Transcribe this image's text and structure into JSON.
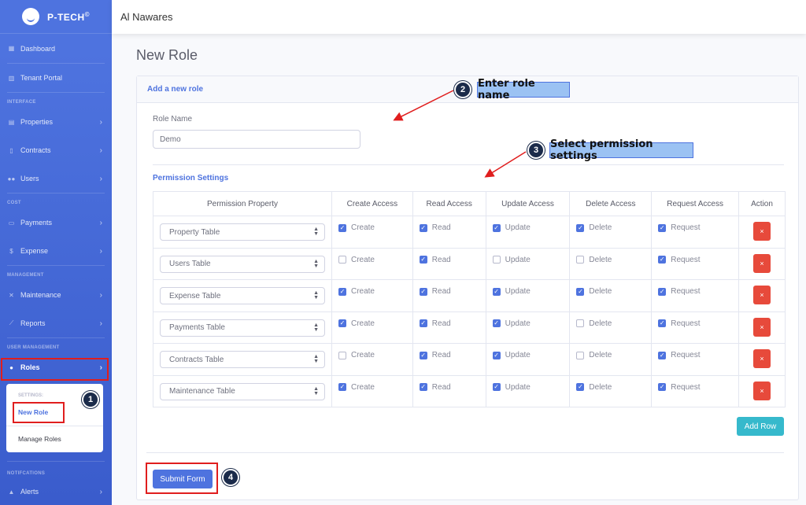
{
  "brand": {
    "name": "P-TECH",
    "mark": "©"
  },
  "topbar": {
    "org": "Al Nawares"
  },
  "sidebar": {
    "dashboard": "Dashboard",
    "tenant_portal": "Tenant Portal",
    "h_interface": "INTERFACE",
    "properties": "Properties",
    "contracts": "Contracts",
    "users": "Users",
    "h_cost": "COST",
    "payments": "Payments",
    "expense": "Expense",
    "h_management": "MANAGEMENT",
    "maintenance": "Maintenance",
    "reports": "Reports",
    "h_user_mgmt": "USER MANAGEMENT",
    "roles": "Roles",
    "sub_heading": "SETTINGS:",
    "new_role": "New Role",
    "manage_roles": "Manage Roles",
    "h_notifications": "NOTIFCATIONS",
    "alerts": "Alerts"
  },
  "page": {
    "title": "New Role"
  },
  "card": {
    "header": "Add a new role"
  },
  "form": {
    "role_label": "Role Name",
    "role_value": "Demo",
    "perm_title": "Permission Settings"
  },
  "table": {
    "headers": [
      "Permission Property",
      "Create Access",
      "Read Access",
      "Update Access",
      "Delete Access",
      "Request Access",
      "Action"
    ],
    "labels": {
      "create": "Create",
      "read": "Read",
      "update": "Update",
      "delete": "Delete",
      "request": "Request",
      "delete_btn": "×"
    },
    "rows": [
      {
        "property": "Property Table",
        "create": true,
        "read": true,
        "update": true,
        "delete": true,
        "request": true
      },
      {
        "property": "Users Table",
        "create": false,
        "read": true,
        "update": false,
        "delete": false,
        "request": true
      },
      {
        "property": "Expense Table",
        "create": true,
        "read": true,
        "update": true,
        "delete": true,
        "request": true
      },
      {
        "property": "Payments Table",
        "create": true,
        "read": true,
        "update": true,
        "delete": false,
        "request": true
      },
      {
        "property": "Contracts Table",
        "create": false,
        "read": true,
        "update": true,
        "delete": false,
        "request": true
      },
      {
        "property": "Maintenance Table",
        "create": true,
        "read": true,
        "update": true,
        "delete": true,
        "request": true
      }
    ]
  },
  "buttons": {
    "add_row": "Add Row",
    "submit": "Submit Form"
  },
  "annotations": {
    "step1": "1",
    "step2": "2",
    "step3": "3",
    "step4": "4",
    "callout2": "Enter role name",
    "callout3": "Select permission settings"
  },
  "colors": {
    "primary": "#4e73df",
    "danger": "#e74a3b",
    "info": "#36b9cc",
    "annotation_red": "#e01e1e"
  }
}
